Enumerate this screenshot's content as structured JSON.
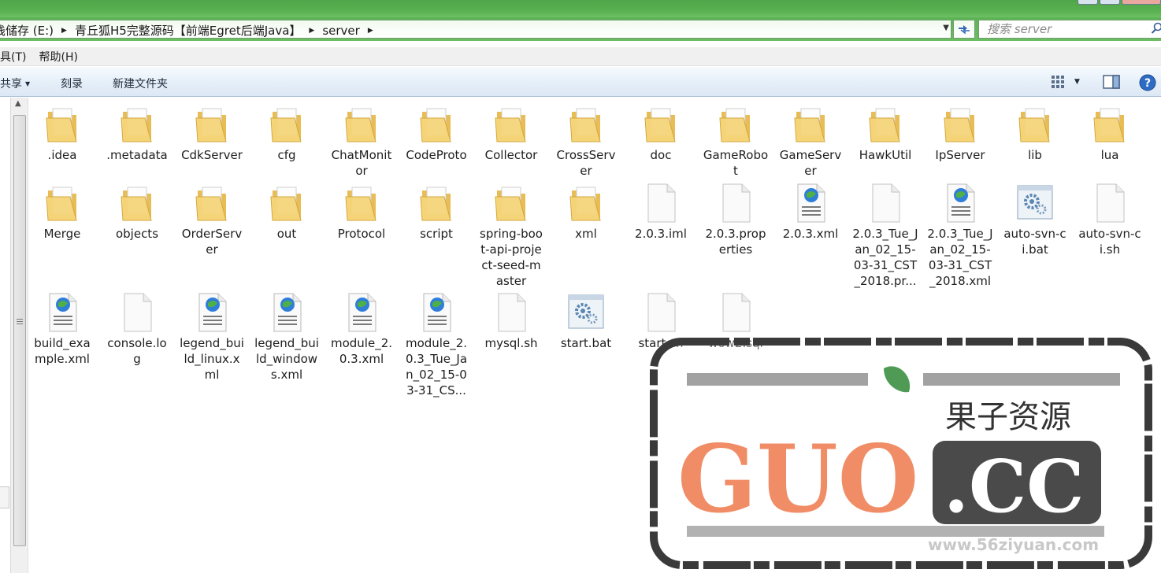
{
  "address": {
    "crumbs": [
      "栈储存 (E:)",
      "青丘狐H5完整源码【前端Egret后端Java】",
      "server"
    ]
  },
  "search": {
    "placeholder": "搜索 server"
  },
  "menu": [
    "具(T)",
    "帮助(H)"
  ],
  "toolbar": {
    "share": "共享",
    "burn": "刻录",
    "new_folder": "新建文件夹"
  },
  "colors": {
    "folder": "#f2cf6e",
    "glass": "#57b04f",
    "toolbar": "#e5eef8",
    "watermark_orange": "#f0845a"
  },
  "rows": [
    [
      {
        "name": ".idea",
        "icon": "folder-icon"
      },
      {
        "name": ".metadata",
        "icon": "folder-icon"
      },
      {
        "name": "CdkServer",
        "icon": "folder-icon"
      },
      {
        "name": "cfg",
        "icon": "folder-icon"
      },
      {
        "name": "ChatMonitor",
        "icon": "folder-icon"
      },
      {
        "name": "CodeProto",
        "icon": "folder-icon"
      },
      {
        "name": "Collector",
        "icon": "folder-icon"
      },
      {
        "name": "CrossServer",
        "icon": "folder-icon"
      },
      {
        "name": "doc",
        "icon": "folder-icon"
      },
      {
        "name": "GameRobot",
        "icon": "folder-icon"
      },
      {
        "name": "GameServer",
        "icon": "folder-icon"
      },
      {
        "name": "HawkUtil",
        "icon": "folder-icon"
      },
      {
        "name": "IpServer",
        "icon": "folder-icon"
      },
      {
        "name": "lib",
        "icon": "folder-icon"
      },
      {
        "name": "lua",
        "icon": "folder-icon"
      }
    ],
    [
      {
        "name": "Merge",
        "icon": "folder-icon"
      },
      {
        "name": "objects",
        "icon": "folder-icon"
      },
      {
        "name": "OrderServer",
        "icon": "folder-icon"
      },
      {
        "name": "out",
        "icon": "folder-icon"
      },
      {
        "name": "Protocol",
        "icon": "folder-icon"
      },
      {
        "name": "script",
        "icon": "folder-icon"
      },
      {
        "name": "spring-boot-api-project-seed-master",
        "icon": "folder-icon"
      },
      {
        "name": "xml",
        "icon": "folder-icon"
      },
      {
        "name": "2.0.3.iml",
        "icon": "blank-file-icon"
      },
      {
        "name": "2.0.3.properties",
        "icon": "blank-file-icon"
      },
      {
        "name": "2.0.3.xml",
        "icon": "xml-file-icon"
      },
      {
        "name": "2.0.3_Tue_Jan_02_15-03-31_CST_2018.pr...",
        "icon": "blank-file-icon"
      },
      {
        "name": "2.0.3_Tue_Jan_02_15-03-31_CST_2018.xml",
        "icon": "xml-file-icon"
      },
      {
        "name": "auto-svn-ci.bat",
        "icon": "bat-file-icon"
      },
      {
        "name": "auto-svn-ci.sh",
        "icon": "blank-file-icon"
      }
    ],
    [
      {
        "name": "build_example.xml",
        "icon": "xml-file-icon"
      },
      {
        "name": "console.log",
        "icon": "blank-file-icon"
      },
      {
        "name": "legend_build_linux.xml",
        "icon": "xml-file-icon"
      },
      {
        "name": "legend_build_windows.xml",
        "icon": "xml-file-icon"
      },
      {
        "name": "module_2.0.3.xml",
        "icon": "xml-file-icon"
      },
      {
        "name": "module_2.0.3_Tue_Jan_02_15-03-31_CS...",
        "icon": "xml-file-icon"
      },
      {
        "name": "mysql.sh",
        "icon": "blank-file-icon"
      },
      {
        "name": "start.bat",
        "icon": "bat-file-icon"
      },
      {
        "name": "start.sh",
        "icon": "blank-file-icon"
      },
      {
        "name": "wow2.sql",
        "icon": "blank-file-icon"
      }
    ]
  ],
  "watermark": {
    "cn": "果子资源",
    "big": "GUO",
    "cc": ".CC",
    "url": "www.56ziyuan.com"
  }
}
